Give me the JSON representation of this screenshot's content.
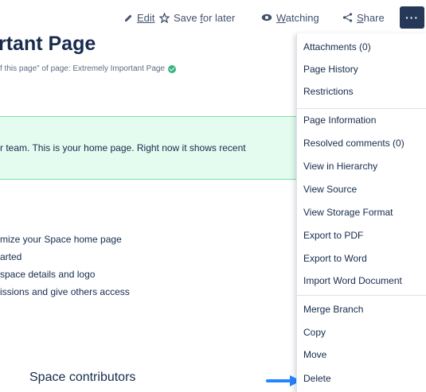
{
  "toolbar": {
    "edit_label": "Edit",
    "save_label_prefix": "Save ",
    "save_label_u": "f",
    "save_label_suffix": "or later",
    "watch_label_u": "W",
    "watch_label_rest": "atching",
    "share_label_u": "S",
    "share_label_rest": "hare",
    "more_label": "···"
  },
  "page": {
    "title": "rtant Page",
    "subtitle": "f this page\" of page: Extremely Important Page",
    "info_text": "r team. This is your home page. Right now it shows recent",
    "list": [
      "mize your Space home page",
      "arted",
      " space details and logo",
      "issions and give others access"
    ],
    "contributors": "Space contributors"
  },
  "menu": {
    "group1": [
      "Attachments (0)",
      "Page History",
      "Restrictions"
    ],
    "group2": [
      "Page Information",
      "Resolved comments (0)",
      "View in Hierarchy",
      "View Source",
      "View Storage Format",
      "Export to PDF",
      "Export to Word",
      "Import Word Document"
    ],
    "group3": [
      "Merge Branch",
      "Copy",
      "Move",
      "Delete"
    ]
  },
  "colors": {
    "accent": "#253858",
    "arrow": "#2684ff",
    "panel_bg": "#e3fcef",
    "panel_border": "#79e2a6",
    "check": "#36b37e"
  },
  "icons": {
    "edit": "pencil-icon",
    "save": "star-icon",
    "watch": "eye-icon",
    "share": "share-icon",
    "more": "more-icon"
  }
}
